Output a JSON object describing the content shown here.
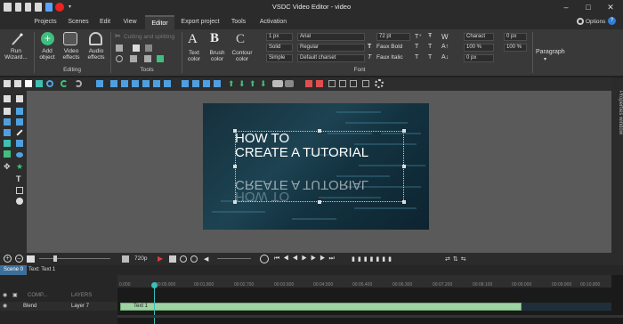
{
  "window": {
    "title": "VSDC Video Editor - video"
  },
  "menu": {
    "items": [
      {
        "label": "Projects",
        "active": false
      },
      {
        "label": "Scenes",
        "active": false
      },
      {
        "label": "Edit",
        "active": false
      },
      {
        "label": "View",
        "active": false
      },
      {
        "label": "Editor",
        "active": true
      },
      {
        "label": "Export project",
        "active": false
      },
      {
        "label": "Tools",
        "active": false
      },
      {
        "label": "Activation",
        "active": false
      }
    ],
    "options_label": "Options"
  },
  "ribbon": {
    "run_wizard": "Run Wizard...",
    "add_object": "Add object",
    "video_effects": "Video effects",
    "audio_effects": "Audio effects",
    "editing_label": "Editing",
    "cutting_splitting": "Cutting and splitting",
    "tools_label": "Tools",
    "text_color": "Text color",
    "brush_color": "Brush color",
    "contour_color": "Contour color",
    "font_label": "Font",
    "paragraph": "Paragraph",
    "line_width": "1 px",
    "line_style": "Solid",
    "line_mode": "Simple",
    "font_name": "Arial",
    "font_style": "Regular",
    "charset": "Default charset",
    "font_size": "72 pt",
    "faux_bold": "Faux Bold",
    "faux_italic": "Faux Italic",
    "char_label": "Charact",
    "char_spacing": "0 px",
    "scale_v": "100 %",
    "scale_h": "100 %",
    "baseline": "0 px"
  },
  "video": {
    "title_line1": "HOW TO",
    "title_line2": "CREATE A TUTORIAL"
  },
  "side_panel": {
    "label": "Properties window"
  },
  "timeline": {
    "resolution": "720p",
    "scene_tab": "Scene 0",
    "object_tab": "Text: Text 1",
    "comp_label": "COMP...",
    "layers_label": "LAYERS",
    "blend_label": "Blend",
    "layer_label": "Layer 7",
    "clip_label": "Text 1",
    "ruler": [
      "0.000",
      "00:00.900",
      "00:01.800",
      "00:02.700",
      "00:03.600",
      "00:04.500",
      "00:05.400",
      "00:06.300",
      "00:07.200",
      "00:08.100",
      "00:09.000",
      "00:09.900",
      "00:10.800"
    ]
  },
  "colors": {
    "accent_green": "#3fbf7f",
    "clip_green": "#9fd3a3",
    "playhead": "#39c0b8",
    "ribbon_bg": "#393939"
  },
  "icons": [
    "save-icon",
    "undo-icon",
    "redo-icon",
    "play-icon",
    "record-icon",
    "add-object-icon",
    "video-effects-icon",
    "audio-effects-icon",
    "wizard-icon"
  ]
}
